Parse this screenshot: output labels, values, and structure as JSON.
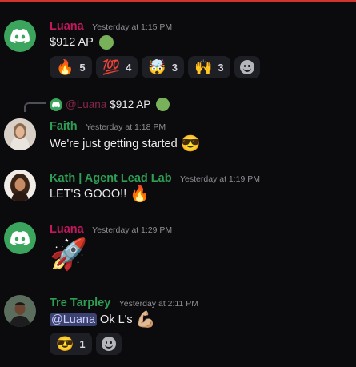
{
  "messages": [
    {
      "username": "Luana",
      "timestamp": "Yesterday at 1:15 PM",
      "text": "$912 AP",
      "reactions": [
        {
          "emoji": "🔥",
          "count": "5"
        },
        {
          "emoji": "💯",
          "count": "4"
        },
        {
          "emoji": "🤯",
          "count": "3"
        },
        {
          "emoji": "🙌",
          "count": "3"
        }
      ]
    },
    {
      "reply": {
        "mention": "@Luana",
        "text": "$912 AP"
      },
      "username": "Faith",
      "timestamp": "Yesterday at 1:18 PM",
      "text": "We're just getting started",
      "emoji": "😎"
    },
    {
      "username": "Kath | Agent Lead Lab",
      "timestamp": "Yesterday at 1:19 PM",
      "text": "LET'S GOOO!!",
      "emoji": "🔥"
    },
    {
      "username": "Luana",
      "timestamp": "Yesterday at 1:29 PM",
      "emoji": "🚀"
    },
    {
      "username": "Tre Tarpley",
      "timestamp": "Yesterday at 2:11 PM",
      "mention": "@Luana",
      "text": "Ok L's",
      "emoji": "💪🏼",
      "reactions": [
        {
          "emoji": "😎",
          "count": "1"
        }
      ]
    }
  ],
  "colors": {
    "background": "#0b0b0d",
    "luana_name": "#c3185c",
    "member_name": "#2e9e54",
    "discord_avatar": "#3ba55d"
  },
  "icons": {
    "discord_avatar": "discord-logo-icon",
    "green_circle": "green-circle-icon",
    "add_reaction": "add-reaction-icon"
  }
}
